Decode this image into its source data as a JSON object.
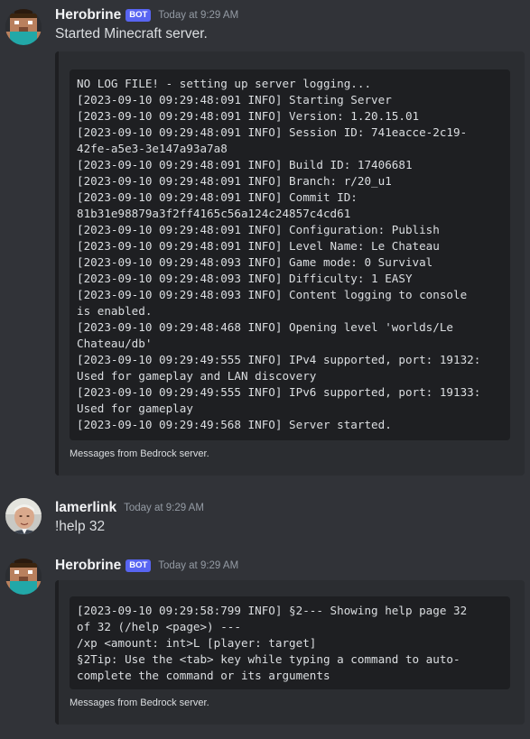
{
  "messages": [
    {
      "username": "Herobrine",
      "bot_tag": "BOT",
      "timestamp": "Today at 9:29 AM",
      "text": "Started Minecraft server.",
      "embed": {
        "code_lines": [
          "NO LOG FILE! - setting up server logging...",
          "[2023-09-10 09:29:48:091 INFO] Starting Server",
          "[2023-09-10 09:29:48:091 INFO] Version: 1.20.15.01",
          "[2023-09-10 09:29:48:091 INFO] Session ID: 741eacce-2c19-",
          "42fe-a5e3-3e147a93a7a8",
          "[2023-09-10 09:29:48:091 INFO] Build ID: 17406681",
          "[2023-09-10 09:29:48:091 INFO] Branch: r/20_u1",
          "[2023-09-10 09:29:48:091 INFO] Commit ID:",
          "81b31e98879a3f2ff4165c56a124c24857c4cd61",
          "[2023-09-10 09:29:48:091 INFO] Configuration: Publish",
          "[2023-09-10 09:29:48:091 INFO] Level Name: Le Chateau",
          "[2023-09-10 09:29:48:093 INFO] Game mode: 0 Survival",
          "[2023-09-10 09:29:48:093 INFO] Difficulty: 1 EASY",
          "[2023-09-10 09:29:48:093 INFO] Content logging to console",
          "is enabled.",
          "[2023-09-10 09:29:48:468 INFO] Opening level 'worlds/Le",
          "Chateau/db'",
          "[2023-09-10 09:29:49:555 INFO] IPv4 supported, port: 19132:",
          "Used for gameplay and LAN discovery",
          "[2023-09-10 09:29:49:555 INFO] IPv6 supported, port: 19133:",
          "Used for gameplay",
          "[2023-09-10 09:29:49:568 INFO] Server started."
        ],
        "footer": "Messages from Bedrock server."
      }
    },
    {
      "username": "lamerlink",
      "timestamp": "Today at 9:29 AM",
      "text": "!help 32"
    },
    {
      "username": "Herobrine",
      "bot_tag": "BOT",
      "timestamp": "Today at 9:29 AM",
      "embed": {
        "code_lines": [
          "[2023-09-10 09:29:58:799 INFO] §2--- Showing help page 32",
          "of 32 (/help <page>) ---",
          "/xp <amount: int>L [player: target]",
          "§2Tip: Use the <tab> key while typing a command to auto-",
          "complete the command or its arguments"
        ],
        "footer": "Messages from Bedrock server."
      }
    }
  ],
  "colors": {
    "background": "#313338",
    "embed_bg": "#2b2d31",
    "code_bg": "#1e1f22",
    "bot_tag": "#5865f2",
    "timestamp": "#949ba4",
    "text": "#dbdee1",
    "username": "#f2f3f5"
  },
  "icons": [
    "herobrine-avatar-icon",
    "lamerlink-avatar-icon"
  ]
}
